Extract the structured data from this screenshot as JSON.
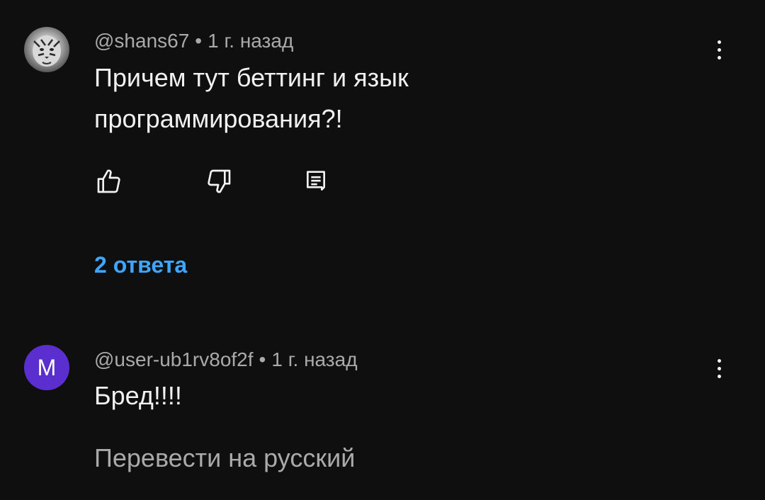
{
  "comments": [
    {
      "author": "@shans67",
      "separator": "•",
      "time": "1 г. назад",
      "text_line1": "Причем тут беттинг и язык",
      "text_line2": "программирования?!",
      "avatar_letter": ""
    },
    {
      "author": "@user-ub1rv8of2f",
      "separator": "•",
      "time": "1 г. назад",
      "text_line1": "Бред!!!!",
      "avatar_letter": "М"
    }
  ],
  "replies_label": "2 ответа",
  "translate_label": "Перевести на русский",
  "icons": {
    "like": "thumbs-up-icon",
    "dislike": "thumbs-down-icon",
    "reply": "comment-icon",
    "more": "more-vert-icon"
  },
  "colors": {
    "background": "#0f0f0f",
    "text": "#f1f1f1",
    "secondary_text": "#aaaaaa",
    "link": "#3ea6ff",
    "avatar_accent": "#5b2fcf"
  }
}
